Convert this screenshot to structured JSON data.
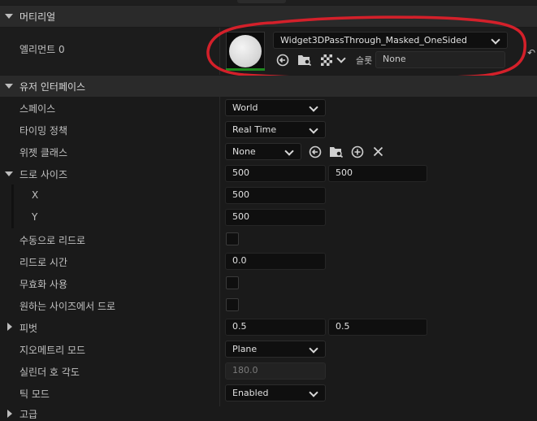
{
  "material": {
    "category_label": "머티리얼",
    "element_label": "엘리먼트 0",
    "material_name": "Widget3DPassThrough_Masked_OneSided",
    "slot_label": "슬롯",
    "slot_value": "None"
  },
  "user_interface": {
    "category_label": "유저 인터페이스",
    "space": {
      "label": "스페이스",
      "value": "World"
    },
    "timing_policy": {
      "label": "타이밍 정책",
      "value": "Real Time"
    },
    "widget_class": {
      "label": "위젯 클래스",
      "value": "None"
    },
    "draw_size": {
      "label": "드로 사이즈",
      "x": "500",
      "y": "500",
      "x_label": "X",
      "y_label": "Y",
      "x_value": "500",
      "y_value": "500"
    },
    "manual_redraw": {
      "label": "수동으로 리드로",
      "checked": false
    },
    "redraw_time": {
      "label": "리드로 시간",
      "value": "0.0"
    },
    "window_focusable": {
      "label": "무효화 사용",
      "checked": false
    },
    "draw_at_desired_size": {
      "label": "원하는 사이즈에서 드로",
      "checked": false
    },
    "pivot": {
      "label": "피벗",
      "x": "0.5",
      "y": "0.5"
    },
    "geometry_mode": {
      "label": "지오메트리 모드",
      "value": "Plane"
    },
    "cylinder_arc_angle": {
      "label": "실린더 호 각도",
      "value": "180.0"
    },
    "tick_mode": {
      "label": "틱 모드",
      "value": "Enabled"
    }
  },
  "advanced": {
    "category_label": "고급"
  },
  "colors": {
    "annotation": "#d4202a",
    "thumbnail_bar": "#1f8a1f"
  }
}
